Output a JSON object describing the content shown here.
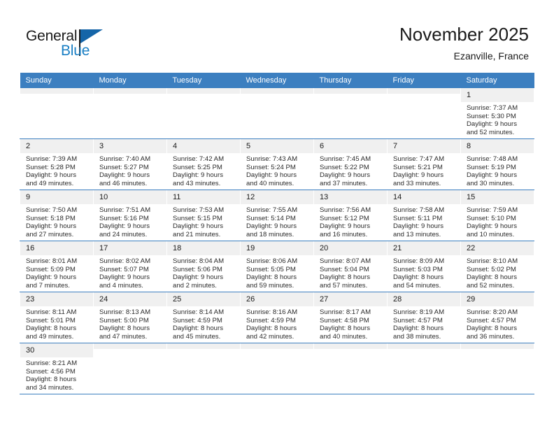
{
  "brand": {
    "name_top": "General",
    "name_bottom": "Blue",
    "accent_color": "#1a7fc4",
    "flag_color": "#1565a8"
  },
  "header": {
    "title": "November 2025",
    "subtitle": "Ezanville, France"
  },
  "theme": {
    "header_row_bg": "#3c7fc0",
    "daynum_bg": "#f0f0f0",
    "grid_line": "#3c7fc0",
    "text": "#2b2b2b"
  },
  "weekday_headers": [
    "Sunday",
    "Monday",
    "Tuesday",
    "Wednesday",
    "Thursday",
    "Friday",
    "Saturday"
  ],
  "weeks": [
    [
      {
        "day": "",
        "blank": true
      },
      {
        "day": "",
        "blank": true
      },
      {
        "day": "",
        "blank": true
      },
      {
        "day": "",
        "blank": true
      },
      {
        "day": "",
        "blank": true
      },
      {
        "day": "",
        "blank": true
      },
      {
        "day": "1",
        "sunrise": "Sunrise: 7:37 AM",
        "sunset": "Sunset: 5:30 PM",
        "daylight_1": "Daylight: 9 hours",
        "daylight_2": "and 52 minutes."
      }
    ],
    [
      {
        "day": "2",
        "sunrise": "Sunrise: 7:39 AM",
        "sunset": "Sunset: 5:28 PM",
        "daylight_1": "Daylight: 9 hours",
        "daylight_2": "and 49 minutes."
      },
      {
        "day": "3",
        "sunrise": "Sunrise: 7:40 AM",
        "sunset": "Sunset: 5:27 PM",
        "daylight_1": "Daylight: 9 hours",
        "daylight_2": "and 46 minutes."
      },
      {
        "day": "4",
        "sunrise": "Sunrise: 7:42 AM",
        "sunset": "Sunset: 5:25 PM",
        "daylight_1": "Daylight: 9 hours",
        "daylight_2": "and 43 minutes."
      },
      {
        "day": "5",
        "sunrise": "Sunrise: 7:43 AM",
        "sunset": "Sunset: 5:24 PM",
        "daylight_1": "Daylight: 9 hours",
        "daylight_2": "and 40 minutes."
      },
      {
        "day": "6",
        "sunrise": "Sunrise: 7:45 AM",
        "sunset": "Sunset: 5:22 PM",
        "daylight_1": "Daylight: 9 hours",
        "daylight_2": "and 37 minutes."
      },
      {
        "day": "7",
        "sunrise": "Sunrise: 7:47 AM",
        "sunset": "Sunset: 5:21 PM",
        "daylight_1": "Daylight: 9 hours",
        "daylight_2": "and 33 minutes."
      },
      {
        "day": "8",
        "sunrise": "Sunrise: 7:48 AM",
        "sunset": "Sunset: 5:19 PM",
        "daylight_1": "Daylight: 9 hours",
        "daylight_2": "and 30 minutes."
      }
    ],
    [
      {
        "day": "9",
        "sunrise": "Sunrise: 7:50 AM",
        "sunset": "Sunset: 5:18 PM",
        "daylight_1": "Daylight: 9 hours",
        "daylight_2": "and 27 minutes."
      },
      {
        "day": "10",
        "sunrise": "Sunrise: 7:51 AM",
        "sunset": "Sunset: 5:16 PM",
        "daylight_1": "Daylight: 9 hours",
        "daylight_2": "and 24 minutes."
      },
      {
        "day": "11",
        "sunrise": "Sunrise: 7:53 AM",
        "sunset": "Sunset: 5:15 PM",
        "daylight_1": "Daylight: 9 hours",
        "daylight_2": "and 21 minutes."
      },
      {
        "day": "12",
        "sunrise": "Sunrise: 7:55 AM",
        "sunset": "Sunset: 5:14 PM",
        "daylight_1": "Daylight: 9 hours",
        "daylight_2": "and 18 minutes."
      },
      {
        "day": "13",
        "sunrise": "Sunrise: 7:56 AM",
        "sunset": "Sunset: 5:12 PM",
        "daylight_1": "Daylight: 9 hours",
        "daylight_2": "and 16 minutes."
      },
      {
        "day": "14",
        "sunrise": "Sunrise: 7:58 AM",
        "sunset": "Sunset: 5:11 PM",
        "daylight_1": "Daylight: 9 hours",
        "daylight_2": "and 13 minutes."
      },
      {
        "day": "15",
        "sunrise": "Sunrise: 7:59 AM",
        "sunset": "Sunset: 5:10 PM",
        "daylight_1": "Daylight: 9 hours",
        "daylight_2": "and 10 minutes."
      }
    ],
    [
      {
        "day": "16",
        "sunrise": "Sunrise: 8:01 AM",
        "sunset": "Sunset: 5:09 PM",
        "daylight_1": "Daylight: 9 hours",
        "daylight_2": "and 7 minutes."
      },
      {
        "day": "17",
        "sunrise": "Sunrise: 8:02 AM",
        "sunset": "Sunset: 5:07 PM",
        "daylight_1": "Daylight: 9 hours",
        "daylight_2": "and 4 minutes."
      },
      {
        "day": "18",
        "sunrise": "Sunrise: 8:04 AM",
        "sunset": "Sunset: 5:06 PM",
        "daylight_1": "Daylight: 9 hours",
        "daylight_2": "and 2 minutes."
      },
      {
        "day": "19",
        "sunrise": "Sunrise: 8:06 AM",
        "sunset": "Sunset: 5:05 PM",
        "daylight_1": "Daylight: 8 hours",
        "daylight_2": "and 59 minutes."
      },
      {
        "day": "20",
        "sunrise": "Sunrise: 8:07 AM",
        "sunset": "Sunset: 5:04 PM",
        "daylight_1": "Daylight: 8 hours",
        "daylight_2": "and 57 minutes."
      },
      {
        "day": "21",
        "sunrise": "Sunrise: 8:09 AM",
        "sunset": "Sunset: 5:03 PM",
        "daylight_1": "Daylight: 8 hours",
        "daylight_2": "and 54 minutes."
      },
      {
        "day": "22",
        "sunrise": "Sunrise: 8:10 AM",
        "sunset": "Sunset: 5:02 PM",
        "daylight_1": "Daylight: 8 hours",
        "daylight_2": "and 52 minutes."
      }
    ],
    [
      {
        "day": "23",
        "sunrise": "Sunrise: 8:11 AM",
        "sunset": "Sunset: 5:01 PM",
        "daylight_1": "Daylight: 8 hours",
        "daylight_2": "and 49 minutes."
      },
      {
        "day": "24",
        "sunrise": "Sunrise: 8:13 AM",
        "sunset": "Sunset: 5:00 PM",
        "daylight_1": "Daylight: 8 hours",
        "daylight_2": "and 47 minutes."
      },
      {
        "day": "25",
        "sunrise": "Sunrise: 8:14 AM",
        "sunset": "Sunset: 4:59 PM",
        "daylight_1": "Daylight: 8 hours",
        "daylight_2": "and 45 minutes."
      },
      {
        "day": "26",
        "sunrise": "Sunrise: 8:16 AM",
        "sunset": "Sunset: 4:59 PM",
        "daylight_1": "Daylight: 8 hours",
        "daylight_2": "and 42 minutes."
      },
      {
        "day": "27",
        "sunrise": "Sunrise: 8:17 AM",
        "sunset": "Sunset: 4:58 PM",
        "daylight_1": "Daylight: 8 hours",
        "daylight_2": "and 40 minutes."
      },
      {
        "day": "28",
        "sunrise": "Sunrise: 8:19 AM",
        "sunset": "Sunset: 4:57 PM",
        "daylight_1": "Daylight: 8 hours",
        "daylight_2": "and 38 minutes."
      },
      {
        "day": "29",
        "sunrise": "Sunrise: 8:20 AM",
        "sunset": "Sunset: 4:57 PM",
        "daylight_1": "Daylight: 8 hours",
        "daylight_2": "and 36 minutes."
      }
    ],
    [
      {
        "day": "30",
        "sunrise": "Sunrise: 8:21 AM",
        "sunset": "Sunset: 4:56 PM",
        "daylight_1": "Daylight: 8 hours",
        "daylight_2": "and 34 minutes."
      },
      {
        "day": "",
        "blank": true
      },
      {
        "day": "",
        "blank": true
      },
      {
        "day": "",
        "blank": true
      },
      {
        "day": "",
        "blank": true
      },
      {
        "day": "",
        "blank": true
      },
      {
        "day": "",
        "blank": true
      }
    ]
  ]
}
